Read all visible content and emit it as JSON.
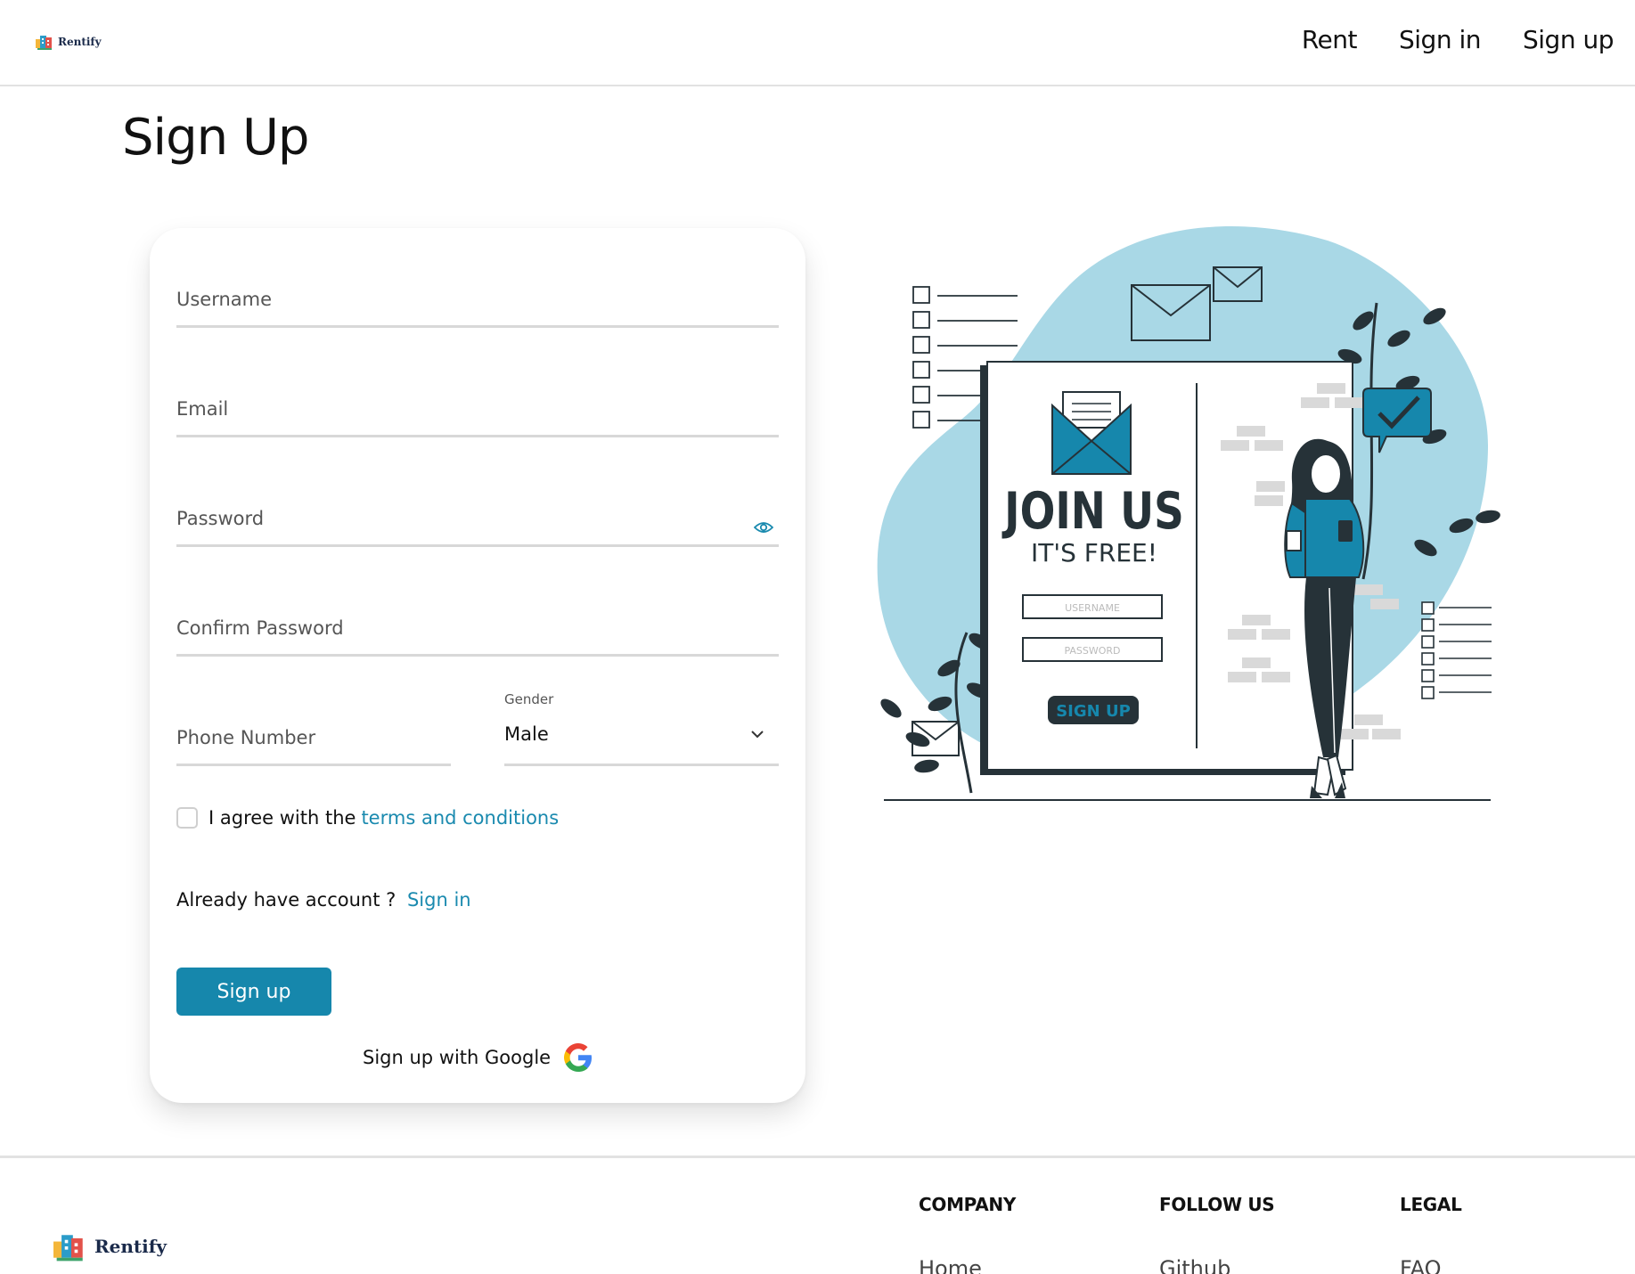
{
  "header": {
    "logo_text": "Rentify",
    "nav": [
      {
        "label": "Rent"
      },
      {
        "label": "Sign in"
      },
      {
        "label": "Sign up"
      }
    ]
  },
  "page": {
    "title": "Sign Up"
  },
  "form": {
    "username_label": "Username",
    "email_label": "Email",
    "password_label": "Password",
    "confirm_password_label": "Confirm Password",
    "phone_label": "Phone Number",
    "gender_label": "Gender",
    "gender_value": "Male",
    "agree_text": "I agree with the",
    "terms_link": "terms and conditions",
    "already_text": "Already have account ?",
    "signin_link": "Sign in",
    "submit_label": "Sign up",
    "google_label": "Sign up with Google"
  },
  "illustration": {
    "headline": "JOIN US",
    "subheadline": "IT'S FREE!",
    "username_box": "USERNAME",
    "password_box": "PASSWORD",
    "button": "SIGN UP"
  },
  "footer": {
    "logo_text": "Rentify",
    "columns": [
      {
        "heading": "COMPANY",
        "link": "Home"
      },
      {
        "heading": "FOLLOW US",
        "link": "Github"
      },
      {
        "heading": "LEGAL",
        "link": "FAQ"
      }
    ]
  },
  "colors": {
    "accent": "#1687ac",
    "link": "#1a8aaf",
    "blob": "#a9d8e6",
    "dark": "#263238"
  }
}
